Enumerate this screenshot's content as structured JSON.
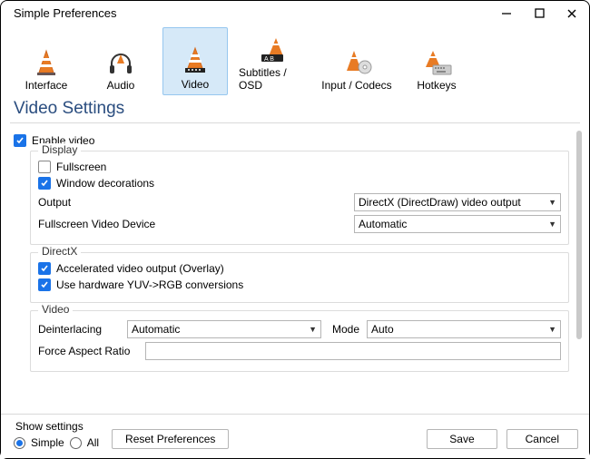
{
  "window": {
    "title": "Simple Preferences"
  },
  "tabs": {
    "interface": "Interface",
    "audio": "Audio",
    "video": "Video",
    "subtitles": "Subtitles / OSD",
    "codecs": "Input / Codecs",
    "hotkeys": "Hotkeys"
  },
  "heading": "Video Settings",
  "enable_video": {
    "label": "Enable video",
    "checked": true
  },
  "display": {
    "legend": "Display",
    "fullscreen": {
      "label": "Fullscreen",
      "checked": false
    },
    "window_decorations": {
      "label": "Window decorations",
      "checked": true
    },
    "output": {
      "label": "Output",
      "value": "DirectX (DirectDraw) video output"
    },
    "fs_device": {
      "label": "Fullscreen Video Device",
      "value": "Automatic"
    }
  },
  "directx": {
    "legend": "DirectX",
    "accel": {
      "label": "Accelerated video output (Overlay)",
      "checked": true
    },
    "yuv": {
      "label": "Use hardware YUV->RGB conversions",
      "checked": true
    }
  },
  "video": {
    "legend": "Video",
    "deinterlacing": {
      "label": "Deinterlacing",
      "value": "Automatic"
    },
    "mode": {
      "label": "Mode",
      "value": "Auto"
    },
    "force_ar": {
      "label": "Force Aspect Ratio",
      "value": ""
    }
  },
  "bottom": {
    "show_settings": "Show settings",
    "simple": "Simple",
    "all": "All",
    "reset": "Reset Preferences",
    "save": "Save",
    "cancel": "Cancel"
  }
}
